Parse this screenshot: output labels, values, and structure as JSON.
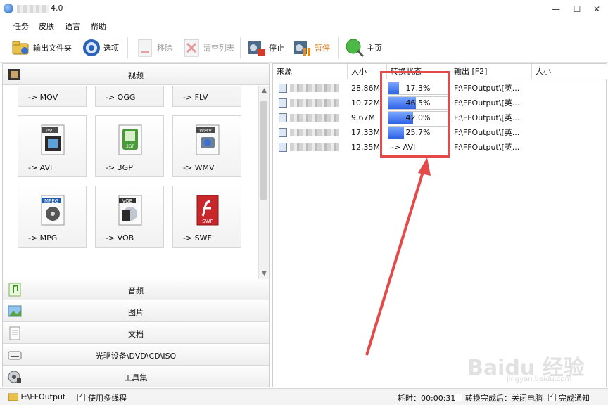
{
  "window": {
    "title_suffix": "4.0",
    "minimize": "—",
    "maximize": "☐",
    "close": "✕"
  },
  "menu": [
    "任务",
    "皮肤",
    "语言",
    "帮助"
  ],
  "toolbar": {
    "output_folder": "输出文件夹",
    "options": "选项",
    "remove": "移除",
    "clear_list": "清空列表",
    "stop": "停止",
    "pause": "暂停",
    "home": "主页"
  },
  "left_panel": {
    "video": "视频",
    "formats": [
      {
        "label": "-> MOV",
        "badge": ""
      },
      {
        "label": "-> OGG",
        "badge": ""
      },
      {
        "label": "-> FLV",
        "badge": ""
      },
      {
        "label": "-> AVI",
        "badge": "AVI"
      },
      {
        "label": "-> 3GP",
        "badge": "3GP"
      },
      {
        "label": "-> WMV",
        "badge": "WMV"
      },
      {
        "label": "-> MPG",
        "badge": "MPEG"
      },
      {
        "label": "-> VOB",
        "badge": "VOB"
      },
      {
        "label": "-> SWF",
        "badge": "SWF"
      }
    ],
    "categories": [
      "音频",
      "图片",
      "文档",
      "光驱设备\\DVD\\CD\\ISO",
      "工具集"
    ]
  },
  "table": {
    "headers": [
      "来源",
      "大小",
      "转换状态",
      "输出 [F2]",
      "大小"
    ],
    "rows": [
      {
        "size": "28.86M",
        "status": "17.3%",
        "progress": 17.3,
        "output": "F:\\FFOutput\\[英..."
      },
      {
        "size": "10.72M",
        "status": "46.5%",
        "progress": 46.5,
        "output": "F:\\FFOutput\\[英..."
      },
      {
        "size": "9.67M",
        "status": "42.0%",
        "progress": 42.0,
        "output": "F:\\FFOutput\\[英..."
      },
      {
        "size": "17.33M",
        "status": "25.7%",
        "progress": 25.7,
        "output": "F:\\FFOutput\\[英..."
      },
      {
        "size": "12.35M",
        "status": "-> AVI",
        "progress": null,
        "output": "F:\\FFOutput\\[英..."
      }
    ]
  },
  "statusbar": {
    "output_path": "F:\\FFOutput",
    "multithread": "使用多线程",
    "elapsed": "耗时：00:00:31",
    "after_convert": "转换完成后：关闭电脑",
    "notify": "完成通知"
  },
  "watermark": {
    "main": "Baidu 经验",
    "sub": "jingyan.baidu.com"
  },
  "colors": {
    "highlight": "#e44a4a",
    "progress": "#2f62e6"
  }
}
